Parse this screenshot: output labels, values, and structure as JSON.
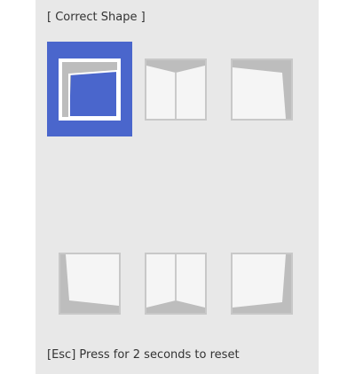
{
  "title": "[ Correct Shape ]",
  "footer": "[Esc] Press for 2 seconds to reset",
  "selected_option": 0,
  "colors": {
    "selected": "#4a66cc",
    "shape": "#bdbdbd",
    "thumb_bg": "#f5f5f5"
  },
  "options": [
    {
      "icon": "corner-top-left-icon"
    },
    {
      "icon": "top-center-icon"
    },
    {
      "icon": "corner-top-right-icon"
    },
    {
      "icon": "corner-bottom-left-icon"
    },
    {
      "icon": "bottom-center-icon"
    },
    {
      "icon": "corner-bottom-right-icon"
    }
  ]
}
